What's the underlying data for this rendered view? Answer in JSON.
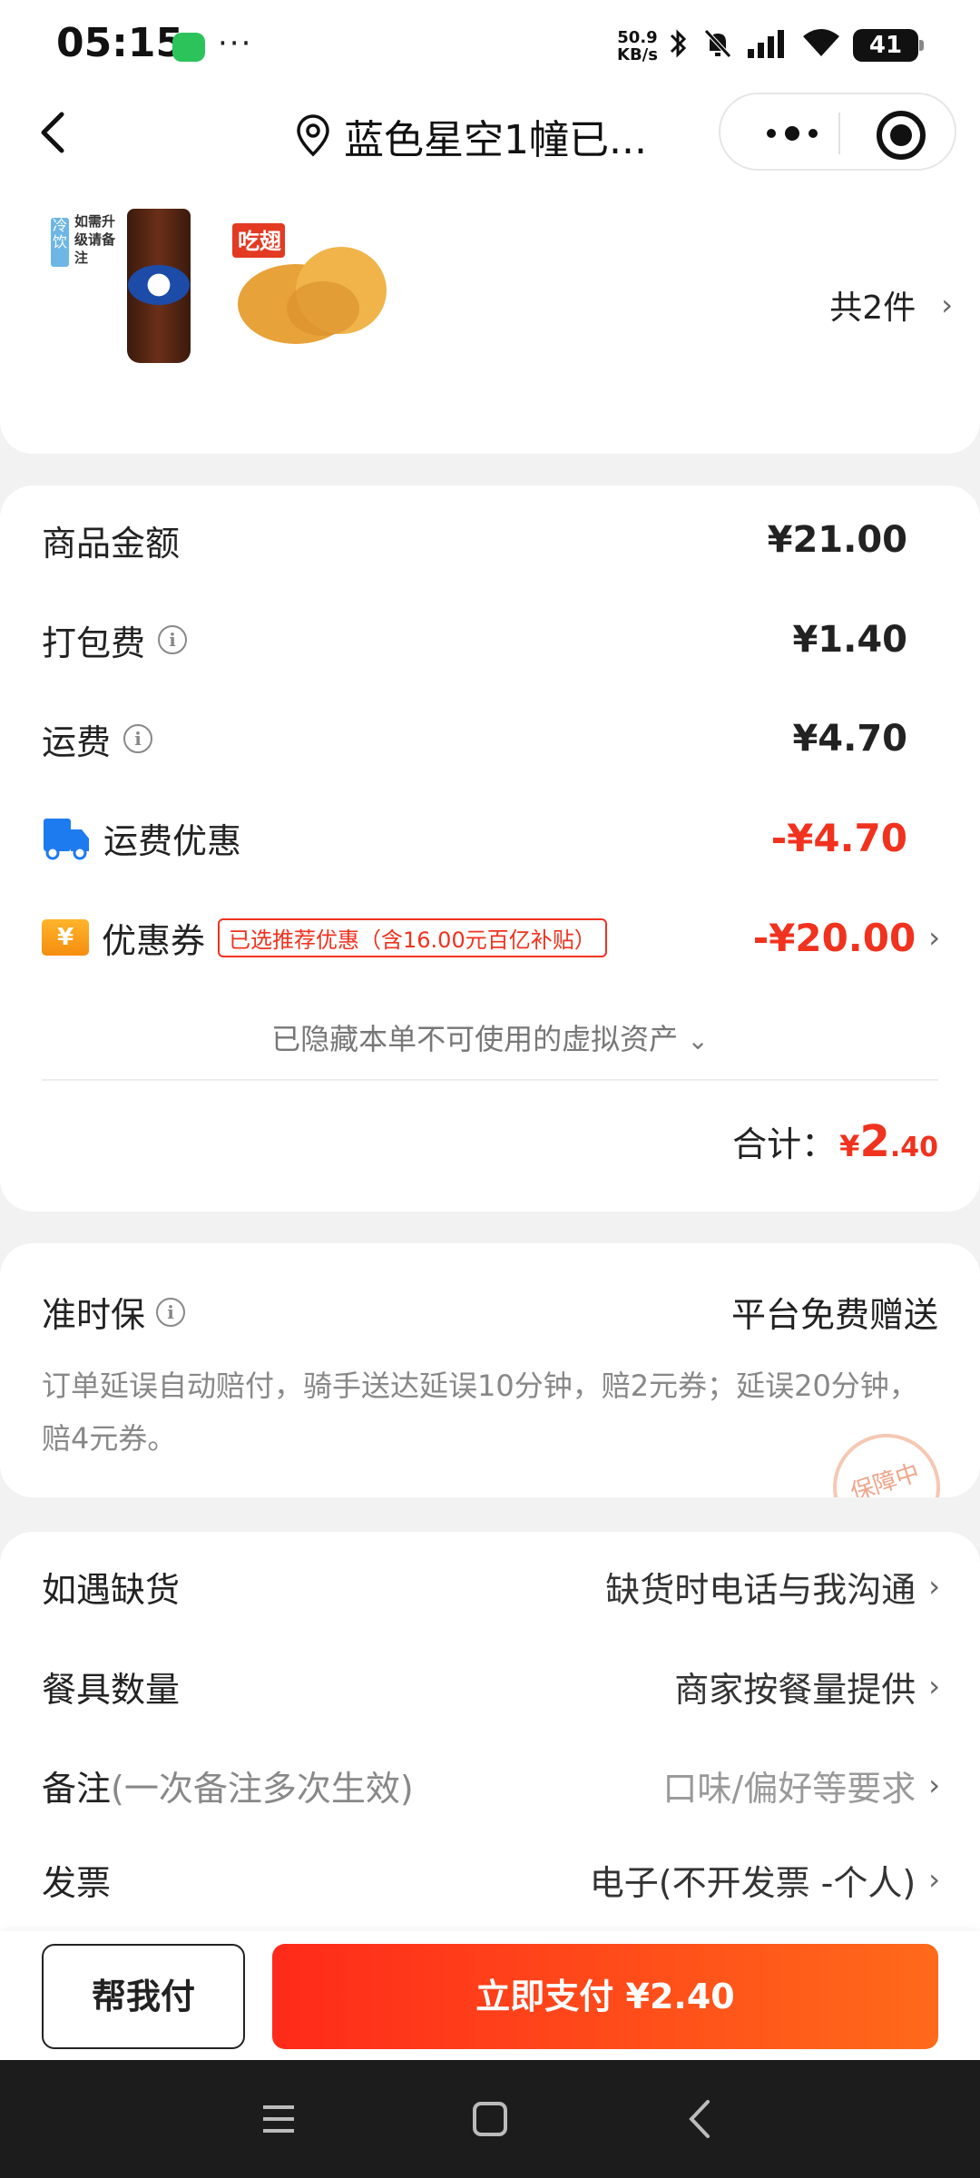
{
  "status_bar": {
    "time": "05:15",
    "net_speed_value": "50.9",
    "net_speed_unit": "KB/s",
    "battery": "41"
  },
  "nav": {
    "title": "蓝色星空1幢已..."
  },
  "products": {
    "total_label": "共2件",
    "item1_text": "如需升级请备注",
    "item1_tag": "冷饮",
    "item2_label": "吃翅"
  },
  "fees": {
    "goods_label": "商品金额",
    "goods_amount": "¥21.00",
    "packing_label": "打包费",
    "packing_amount": "¥1.40",
    "shipping_label": "运费",
    "shipping_amount": "¥4.70",
    "shipping_discount_label": "运费优惠",
    "shipping_discount_amount": "-¥4.70",
    "coupon_label": "优惠券",
    "coupon_tag": "已选推荐优惠（含16.00元百亿补贴）",
    "coupon_amount": "-¥20.00",
    "hidden_assets": "已隐藏本单不可使用的虚拟资产",
    "subtotal_label": "合计：",
    "subtotal_currency": "¥",
    "subtotal_int": "2",
    "subtotal_dec": ".40"
  },
  "ontime": {
    "title": "准时保",
    "right": "平台免费赠送",
    "desc": "订单延误自动赔付，骑手送达延误10分钟，赔2元券；延误20分钟，赔4元券。",
    "stamp": "保障中"
  },
  "options": {
    "stockout_label": "如遇缺货",
    "stockout_value": "缺货时电话与我沟通",
    "tableware_label": "餐具数量",
    "tableware_value": "商家按餐量提供",
    "remark_label": "备注",
    "remark_sub": "(一次备注多次生效)",
    "remark_placeholder": "口味/偏好等要求",
    "invoice_label": "发票",
    "invoice_value": "电子(不开发票 -个人)"
  },
  "bottom": {
    "help_pay": "帮我付",
    "pay_now": "立即支付 ¥2.40"
  },
  "colors": {
    "accent_red": "#f0321e",
    "pay_gradient_start": "#ff2a1a",
    "pay_gradient_end": "#ff6a1a"
  }
}
